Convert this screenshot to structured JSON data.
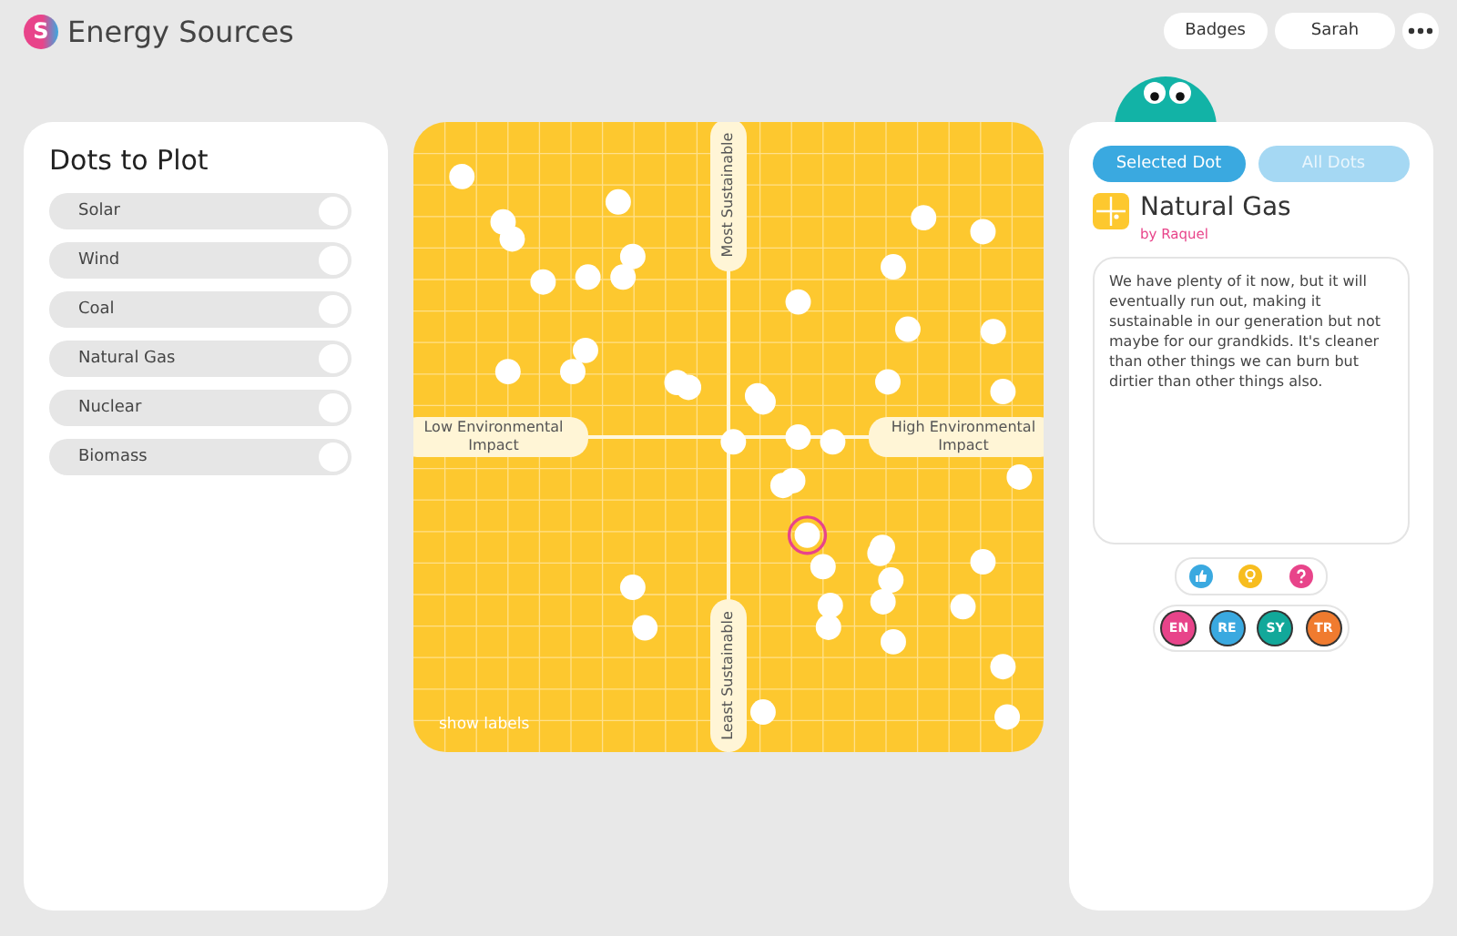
{
  "header": {
    "title": "Energy Sources",
    "logo_letter": "S",
    "buttons": [
      "Badges",
      "Sarah"
    ]
  },
  "dots_panel": {
    "title": "Dots to Plot",
    "items": [
      {
        "label": "Solar"
      },
      {
        "label": "Wind"
      },
      {
        "label": "Coal"
      },
      {
        "label": "Natural Gas"
      },
      {
        "label": "Nuclear"
      },
      {
        "label": "Biomass"
      }
    ]
  },
  "plot": {
    "top_label": "Most Sustainable",
    "bottom_label": "Least Sustainable",
    "left_label": "Low Environmental Impact",
    "right_label": "High Environmental Impact",
    "show_labels": "show labels"
  },
  "detail": {
    "tabs": [
      {
        "label": "Selected Dot",
        "selected": true
      },
      {
        "label": "All Dots",
        "selected": false
      }
    ],
    "title": "Natural Gas",
    "author": "by Raquel",
    "text": "We have plenty of it now, but it will eventually run out, making it sustainable in our generation but not maybe for our grandkids. It's cleaner than other things we can burn but dirtier than other things also.",
    "reactions": [
      {
        "kind": "like",
        "color": "#3aa9e0"
      },
      {
        "kind": "idea",
        "color": "#f7bd1f"
      },
      {
        "kind": "question",
        "color": "#e8448a"
      }
    ],
    "badges": [
      {
        "label": "EN",
        "color": "#e8448a"
      },
      {
        "label": "RE",
        "color": "#3aa9e0"
      },
      {
        "label": "SY",
        "color": "#12a89a"
      },
      {
        "label": "TR",
        "color": "#f07b2f"
      }
    ]
  }
}
